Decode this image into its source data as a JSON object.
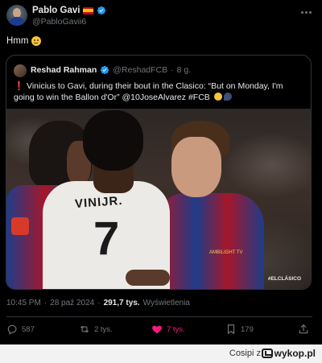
{
  "tweet": {
    "author": {
      "name": "Pablo Gavi",
      "handle": "@PabloGavii6",
      "flag": "spain-flag-emoji",
      "verified_icon": "verified-badge-icon"
    },
    "text": "Hmm",
    "text_emoji": "face-with-raised-eyebrow-emoji",
    "more_icon": "more-options-icon"
  },
  "quote": {
    "author": {
      "name": "Reshad Rahman",
      "handle": "@ReshadFCB",
      "separator": "·",
      "time": "8 g."
    },
    "text_prefix": "❗",
    "text": "Vinicius to Gavi, during their bout in the Clasico: “But on Monday, I'm going to win the Ballon d'Or” @10JoseAlvarez #FCB",
    "emojis": [
      "soccer-ball-emoji",
      "speaking-head-emoji"
    ],
    "image": {
      "description_icon": "football-players-photo",
      "shirt_name": "VINIJR.",
      "shirt_number": "7",
      "sponsor": "AMBILIGHT TV",
      "watermark": "#ELCLÁSICO"
    }
  },
  "meta": {
    "time": "10:45 PM",
    "separator1": "·",
    "date": "28 paź 2024",
    "separator2": "·",
    "views_count": "291,7 tys.",
    "views_label": "Wyświetlenia"
  },
  "actions": {
    "reply": {
      "icon": "reply-icon",
      "count": "587"
    },
    "repost": {
      "icon": "repost-icon",
      "count": "2 tys."
    },
    "like": {
      "icon": "heart-icon",
      "count": "7 tys.",
      "color": "#f91880"
    },
    "bookmark": {
      "icon": "bookmark-icon",
      "count": "179"
    },
    "share": {
      "icon": "share-icon"
    }
  },
  "footer": {
    "credit": "Cosipi z",
    "brand": "wykop.pl"
  },
  "colors": {
    "background": "#000000",
    "text": "#e7e9ea",
    "muted": "#71767b",
    "verified": "#1d9bf0",
    "border": "#2f3336"
  }
}
